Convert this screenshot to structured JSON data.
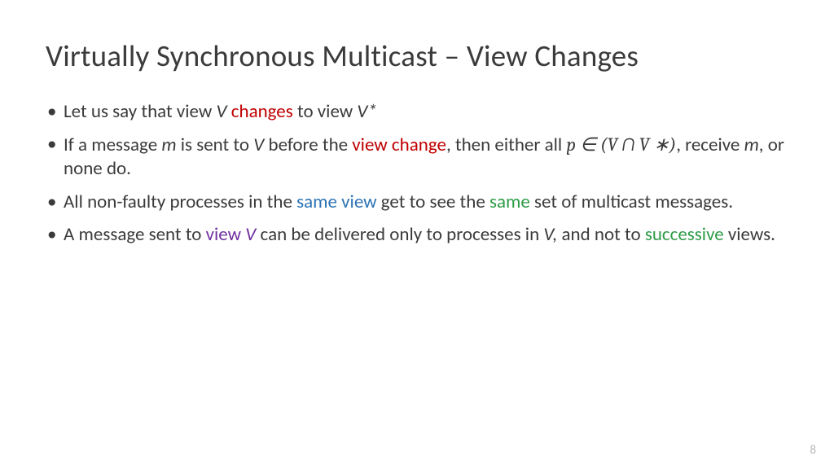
{
  "title": "Virtually Synchronous Multicast – View Changes",
  "b1": {
    "t1": "Let us say that view ",
    "v": "V ",
    "changes": "changes",
    "t2": " to view ",
    "vstar": "V*"
  },
  "b2": {
    "t1": "If a message ",
    "m": "m",
    "t2": " is sent to ",
    "v": "V",
    "t3": " before the ",
    "viewchange": "view change",
    "t4": ", then either all ",
    "math": "p  ∈ (V  ∩ V ∗)",
    "t5": ", receive ",
    "m2": "m",
    "t6": ", or none do."
  },
  "b3": {
    "t1": "All non-faulty processes in the ",
    "sameview": "same view",
    "t2": " get to see the ",
    "same": "same",
    "t3": " set of multicast messages."
  },
  "b4": {
    "t1": "A message sent to ",
    "viewV": "view ",
    "viewV_it": "V",
    "t2": " can be delivered only to processes in ",
    "v": "V,",
    "t3": " and not to ",
    "succ": "successive",
    "t4": " views."
  },
  "pagenum": "8"
}
